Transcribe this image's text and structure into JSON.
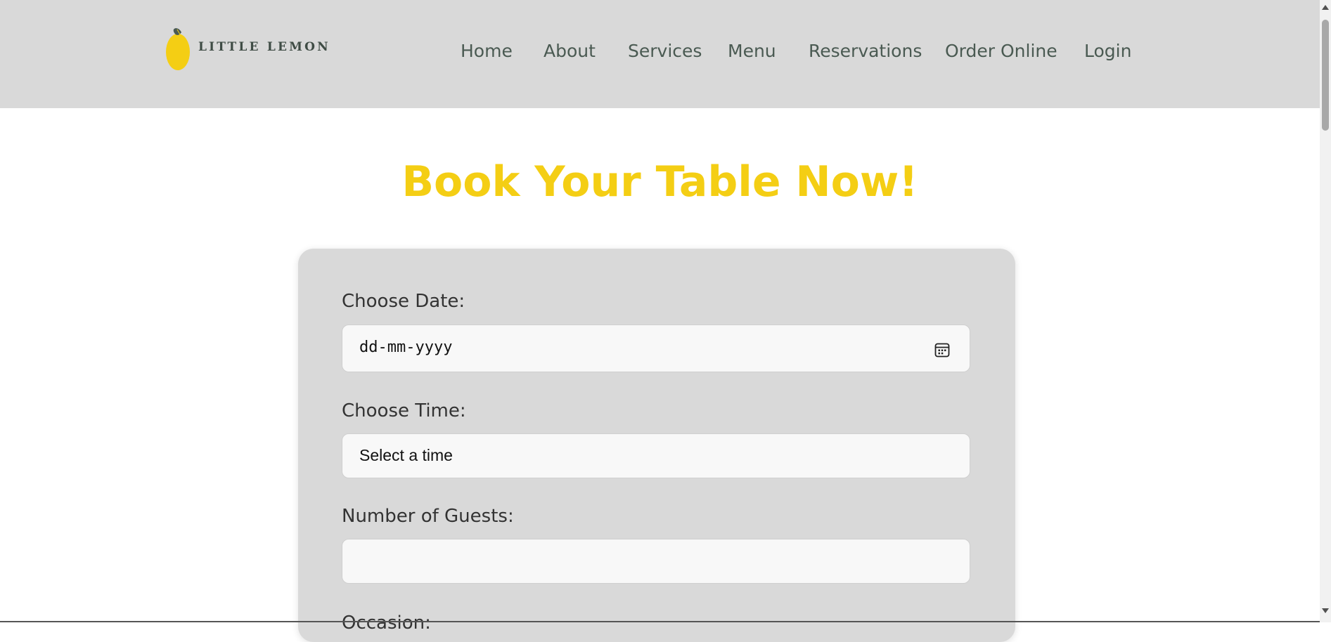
{
  "brand": {
    "name": "LITTLE LEMON",
    "accent_color": "#f4ce14",
    "dark_color": "#495e57"
  },
  "nav": {
    "items": [
      {
        "label": "Home"
      },
      {
        "label": "About"
      },
      {
        "label": "Services"
      },
      {
        "label": "Menu"
      },
      {
        "label": "Reservations"
      },
      {
        "label": "Order Online"
      },
      {
        "label": "Login"
      }
    ]
  },
  "main": {
    "title": "Book Your Table Now!"
  },
  "form": {
    "date": {
      "label": "Choose Date:",
      "placeholder": "dd-mm-yyyy",
      "icon": "calendar-icon"
    },
    "time": {
      "label": "Choose Time:",
      "selected": "Select a time"
    },
    "guests": {
      "label": "Number of Guests:",
      "value": ""
    },
    "occasion": {
      "label": "Occasion:"
    }
  }
}
